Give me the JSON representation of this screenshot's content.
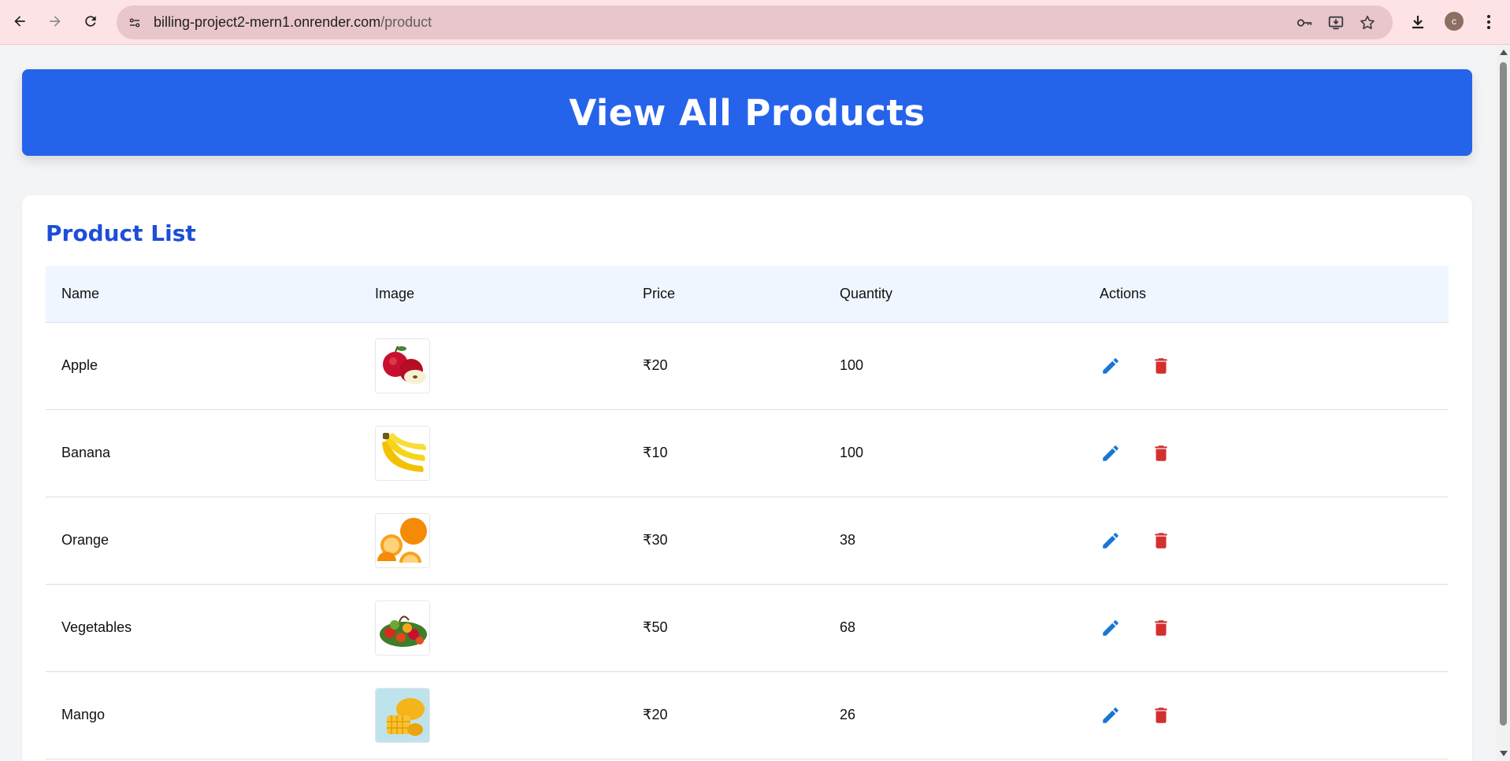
{
  "browser": {
    "url_host": "billing-project2-mern1.onrender.com",
    "url_path": "/product",
    "profile_initial": "c"
  },
  "header": {
    "title": "View All Products"
  },
  "product_list": {
    "title": "Product List",
    "columns": [
      "Name",
      "Image",
      "Price",
      "Quantity",
      "Actions"
    ],
    "rows": [
      {
        "name": "Apple",
        "image": "apple-image",
        "price": "₹20",
        "quantity": "100"
      },
      {
        "name": "Banana",
        "image": "banana-image",
        "price": "₹10",
        "quantity": "100"
      },
      {
        "name": "Orange",
        "image": "orange-image",
        "price": "₹30",
        "quantity": "38"
      },
      {
        "name": "Vegetables",
        "image": "vegetables-image",
        "price": "₹50",
        "quantity": "68"
      },
      {
        "name": "Mango",
        "image": "mango-image",
        "price": "₹20",
        "quantity": "26"
      }
    ]
  },
  "icons": {
    "edit": "pencil-icon",
    "delete": "trash-icon"
  },
  "colors": {
    "banner": "#2563eb",
    "title": "#1d4ed8",
    "edit": "#1976d2",
    "delete": "#d32f2f"
  }
}
